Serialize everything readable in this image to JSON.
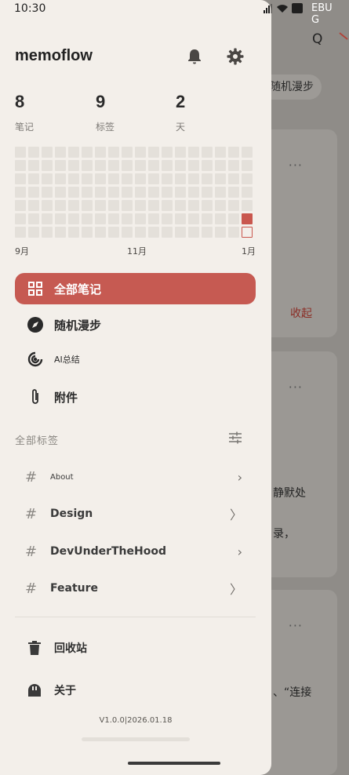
{
  "status_bar": {
    "time": "10:30"
  },
  "background": {
    "debug_lines": [
      "EBU",
      "G"
    ],
    "search_letter": "Q",
    "chip_label": "随机漫步",
    "card_dots": "···",
    "card1_action": "收起",
    "card2_lines": [
      "静默处",
      "录，"
    ],
    "card3_text": "、“连接"
  },
  "drawer": {
    "app_name": "memoflow",
    "stats": [
      {
        "value": "8",
        "label": "笔记"
      },
      {
        "value": "9",
        "label": "标签"
      },
      {
        "value": "2",
        "label": "天"
      }
    ],
    "heatmap_months": [
      "9月",
      "11月",
      "1月"
    ],
    "nav": [
      {
        "label": "全部笔记",
        "icon": "grid-icon",
        "active": true
      },
      {
        "label": "随机漫步",
        "icon": "compass-icon"
      },
      {
        "label": "AI总结",
        "icon": "ai-swirl-icon"
      },
      {
        "label": "附件",
        "icon": "paperclip-icon"
      }
    ],
    "tags_section_title": "全部标签",
    "tags": [
      {
        "name": "About",
        "chevron": "›"
      },
      {
        "name": "Design",
        "chevron": "〉"
      },
      {
        "name": "DevUnderTheHood",
        "chevron": "›"
      },
      {
        "name": "Feature",
        "chevron": "〉"
      }
    ],
    "hash_symbol": "#",
    "footer": [
      {
        "label": "回收站",
        "icon": "trash-icon"
      },
      {
        "label": "关于",
        "icon": "info-face-icon"
      }
    ],
    "version": "V1.0.0|2026.01.18"
  },
  "colors": {
    "accent": "#c65a52",
    "drawer_bg": "#f3efea",
    "heat_empty": "#e4e0da",
    "heat_active": "#c9574e"
  }
}
